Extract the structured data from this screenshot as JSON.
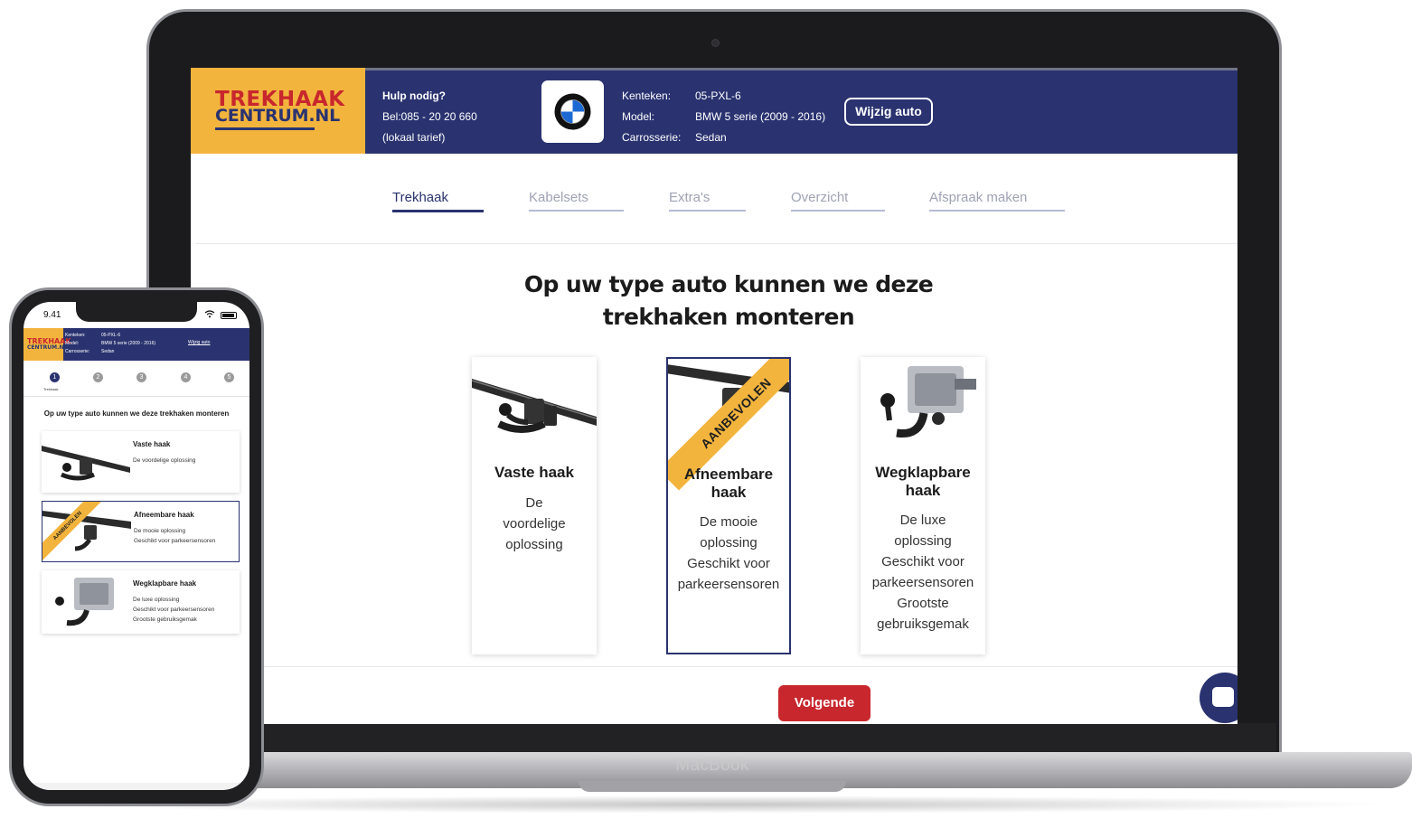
{
  "laptop": {
    "brand_label": "MacBook",
    "logo": {
      "line1": "TREKHAAK",
      "line2": "CENTRUM.NL"
    },
    "help": {
      "title": "Hulp nodig?",
      "phone": "Bel:085 - 20 20 660",
      "note": "(lokaal tarief)"
    },
    "car_brand_icon": "bmw-logo-icon",
    "car": {
      "rows": [
        {
          "key": "Kenteken:",
          "value": "05-PXL-6"
        },
        {
          "key": "Model:",
          "value": "BMW 5 serie (2009 - 2016)"
        },
        {
          "key": "Carrosserie:",
          "value": "Sedan"
        }
      ]
    },
    "wijzig_label": "Wijzig auto",
    "tabs": [
      "Trekhaak",
      "Kabelsets",
      "Extra's",
      "Overzicht",
      "Afspraak maken"
    ],
    "active_tab": 0,
    "title": "Op uw type auto kunnen we deze trekhaken monteren",
    "cards": [
      {
        "name": "Vaste haak",
        "desc": [
          "De",
          "voordelige",
          "oplossing"
        ],
        "selected": false
      },
      {
        "name": "Afneembare haak",
        "desc": [
          "De mooie",
          "oplossing",
          "Geschikt voor",
          "parkeersensoren"
        ],
        "selected": true,
        "ribbon": "AANBEVOLEN"
      },
      {
        "name": "Wegklapbare haak",
        "desc": [
          "De luxe",
          "oplossing",
          "Geschikt voor",
          "parkeersensoren",
          "Grootste",
          "gebruiksgemak"
        ],
        "selected": false
      }
    ],
    "next_label": "Volgende",
    "chat_icon": "chat-icon"
  },
  "phone": {
    "time": "9.41",
    "status_icons": "wifi-icon battery-icon",
    "logo": {
      "line1": "TREKHAAK",
      "line2": "CENTRUM.NL"
    },
    "car": {
      "rows": [
        {
          "key": "Kenteken:",
          "value": "05-PXL-6"
        },
        {
          "key": "Model:",
          "value": "BMW 5 serie (2009 - 2016)"
        },
        {
          "key": "Carrosserie:",
          "value": "Sedan"
        }
      ]
    },
    "wijzig_label": "Wijzig auto",
    "steps": [
      "1",
      "2",
      "3",
      "4",
      "5"
    ],
    "step_label": "Trekhaak",
    "title": "Op uw type auto kunnen we deze trekhaken monteren",
    "cards": [
      {
        "name": "Vaste haak",
        "desc": [
          "De voordelige oplossing"
        ]
      },
      {
        "name": "Afneembare haak",
        "desc": [
          "De mooie oplossing",
          "Geschikt voor parkeersensoren"
        ],
        "ribbon": "AANBEVOLEN"
      },
      {
        "name": "Wegklapbare haak",
        "desc": [
          "De luxe oplossing",
          "Geschikt voor parkeersensoren",
          "Grootste gebruiksgemak"
        ]
      }
    ]
  },
  "colors": {
    "navy": "#2a3370",
    "yellow": "#f3b43d",
    "red": "#c8272d"
  }
}
